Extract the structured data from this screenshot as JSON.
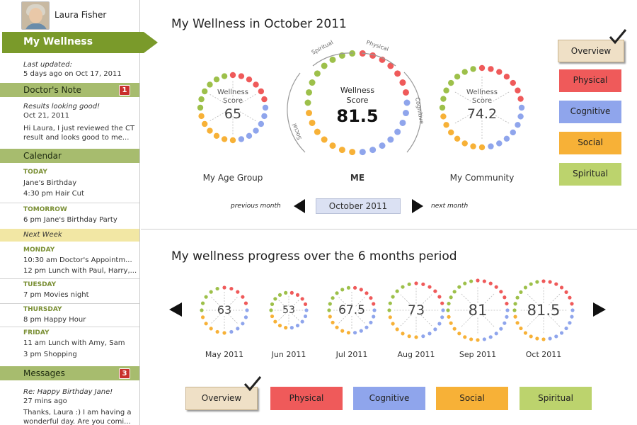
{
  "profile": {
    "name": "Laura Fisher"
  },
  "nav": {
    "active": "My Wellness"
  },
  "updated": {
    "label": "Last updated:",
    "value": "5 days ago on Oct 17, 2011"
  },
  "doctor_note": {
    "title": "Doctor's Note",
    "count": "1",
    "subject": "Results looking good!",
    "date": "Oct 21, 2011",
    "line1": "Hi Laura, I just reviewed the CT",
    "line2": "result and looks good to me..."
  },
  "calendar": {
    "title": "Calendar",
    "today_label": "TODAY",
    "today_1": "Jane's Birthday",
    "today_2": "4:30 pm Hair Cut",
    "tomorrow_label": "TOMORROW",
    "tomorrow_1": "6 pm Jane's Birthday Party",
    "next_week": "Next Week",
    "monday_label": "MONDAY",
    "monday_1": "10:30 am Doctor's Appointm...",
    "monday_2": "12 pm Lunch with Paul, Harry,...",
    "tuesday_label": "TUESDAY",
    "tuesday_1": "7 pm Movies night",
    "thursday_label": "THURSDAY",
    "thursday_1": "8 pm Happy Hour",
    "friday_label": "FRIDAY",
    "friday_1": "11 am Lunch with Amy, Sam",
    "friday_2": "3 pm Shopping"
  },
  "messages": {
    "title": "Messages",
    "count": "3",
    "subject": "Re: Happy Birthday Jane!",
    "time": "27 mins ago",
    "line1": "Thanks, Laura :) I am having a",
    "line2": "wonderful day. Are you comi..."
  },
  "main": {
    "title": "My Wellness in October 2011",
    "age_group": {
      "caption": "Wellness",
      "caption2": "Score",
      "value": "65",
      "label": "My Age Group"
    },
    "me": {
      "caption": "Wellness",
      "caption2": "Score",
      "value": "81.5",
      "label": "ME",
      "arc_physical": "Physical",
      "arc_spiritual": "Spiritual",
      "arc_cognitive": "Cognitive",
      "arc_social": "Social"
    },
    "community": {
      "caption": "Wellness",
      "caption2": "Score",
      "value": "74.2",
      "label": "My Community"
    },
    "prev_month": "previous month",
    "next_month": "next month",
    "current_month": "October 2011"
  },
  "buttons": {
    "overview": "Overview",
    "physical": "Physical",
    "cognitive": "Cognitive",
    "social": "Social",
    "spiritual": "Spiritual"
  },
  "progress": {
    "title": "My wellness progress over the 6 months period",
    "months": [
      {
        "value": "63",
        "label": "May 2011"
      },
      {
        "value": "53",
        "label": "Jun 2011"
      },
      {
        "value": "67.5",
        "label": "Jul 2011"
      },
      {
        "value": "73",
        "label": "Aug 2011"
      },
      {
        "value": "81",
        "label": "Sep 2011"
      },
      {
        "value": "81.5",
        "label": "Oct 2011"
      }
    ]
  },
  "colors": {
    "green": "#7a9a2a",
    "physical": "#ef5a5a",
    "cognitive": "#8fa5ec",
    "social": "#f7b137",
    "spiritual": "#9dc04a"
  }
}
